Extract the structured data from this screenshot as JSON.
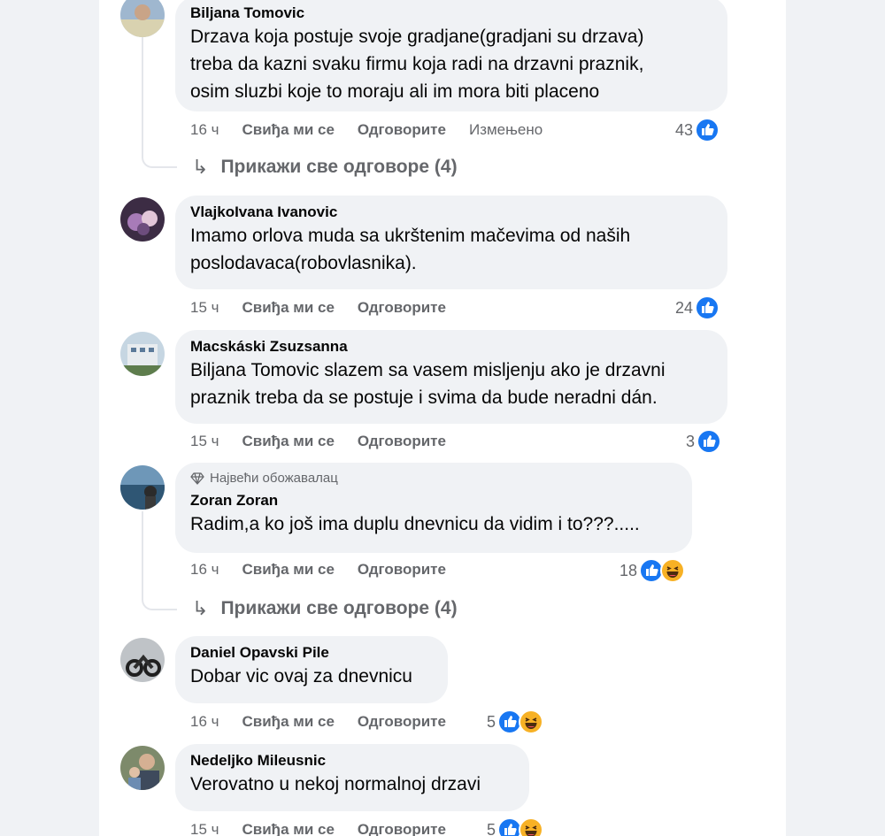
{
  "comments": [
    {
      "author": "Biljana Tomovic",
      "lines": [
        "Drzava koja postuje svoje gradjane(gradjani su drzava)",
        "treba da kazni svaku firmu koja radi na drzavni praznik,",
        "osim sluzbi koje to moraju ali im mora biti placeno"
      ],
      "time": "16 ч",
      "like_label": "Свиђа ми се",
      "reply_label": "Одговорите",
      "edited_label": "Измењено",
      "reaction_count": "43",
      "reactions": [
        "like-icon"
      ],
      "replies_label": "Прикажи све одговоре (4)"
    },
    {
      "author": "VlajkoIvana Ivanovic",
      "lines": [
        "Imamo orlova muda sa ukrštenim mačevima od naših",
        "poslodavaca(robovlasnika)."
      ],
      "time": "15 ч",
      "like_label": "Свиђа ми се",
      "reply_label": "Одговорите",
      "reaction_count": "24",
      "reactions": [
        "like-icon"
      ]
    },
    {
      "author": "Macskáski Zsuzsanna",
      "lines": [
        "Biljana Tomovic slazem sa vasem misljenju ako je drzavni",
        "praznik treba da se postuje i svima da bude neradni dán."
      ],
      "time": "15 ч",
      "like_label": "Свиђа ми се",
      "reply_label": "Одговорите",
      "reaction_count": "3",
      "reactions": [
        "like-icon"
      ]
    },
    {
      "badge": "Највећи обожавалац",
      "author": "Zoran Zoran",
      "lines": [
        "Radim,a ko još ima duplu dnevnicu da vidim i to???....."
      ],
      "time": "16 ч",
      "like_label": "Свиђа ми се",
      "reply_label": "Одговорите",
      "reaction_count": "18",
      "reactions": [
        "like-icon",
        "haha-icon"
      ],
      "replies_label": "Прикажи све одговоре (4)"
    },
    {
      "author": "Daniel Opavski Pile",
      "lines": [
        "Dobar vic ovaj za dnevnicu"
      ],
      "time": "16 ч",
      "like_label": "Свиђа ми се",
      "reply_label": "Одговорите",
      "reaction_count": "5",
      "reactions": [
        "like-icon",
        "haha-icon"
      ]
    },
    {
      "author": "Nedeljko Mileusnic",
      "lines": [
        "Verovatno u nekoj normalnoj drzavi"
      ],
      "time": "15 ч",
      "like_label": "Свиђа ми се",
      "reply_label": "Одговорите",
      "reaction_count": "5",
      "reactions": [
        "like-icon",
        "haha-icon"
      ]
    }
  ],
  "colors": {
    "like_blue": "#1877f2",
    "haha_yellow": "#f7b125",
    "bubble_bg": "#f0f2f5",
    "secondary_text": "#65676b"
  }
}
